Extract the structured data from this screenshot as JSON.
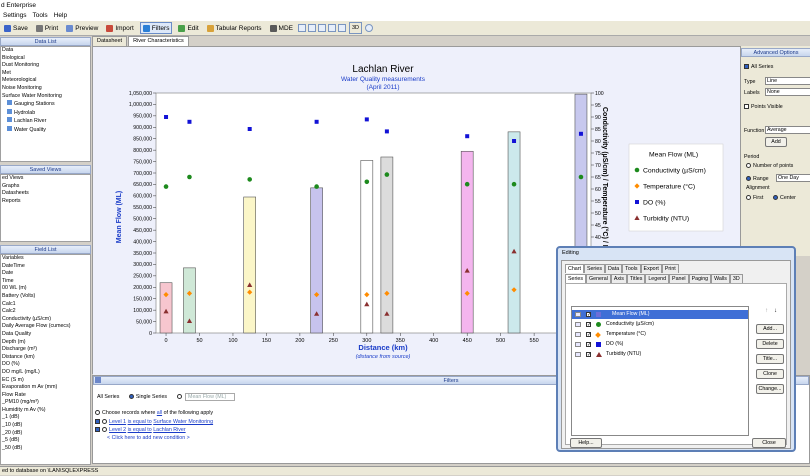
{
  "window": {
    "title": "d Enterprise"
  },
  "menu": [
    "Settings",
    "Tools",
    "Help"
  ],
  "toolbar": {
    "save": "Save",
    "print": "Print",
    "preview": "Preview",
    "import": "Import",
    "filters": "Filters",
    "edit": "Edit",
    "tabular": "Tabular Reports",
    "mde": "MDE",
    "threed": "3D"
  },
  "data_list": {
    "header": "Data List",
    "items": [
      "Data",
      "Biological",
      "Dust Monitoring",
      "Met",
      "Meteorological",
      "Noise Monitoring",
      "Surface Water Monitoring",
      "Gauging Stations",
      "Hydrolab",
      "Lachlan River",
      "Water Quality"
    ]
  },
  "saved_views": {
    "header": "Saved Views",
    "items": [
      "ed Views",
      "Graphs",
      "Datasheets",
      "Reports"
    ]
  },
  "field_list": {
    "header": "Field List",
    "items": [
      "Variables",
      "DateTime",
      "Date",
      "Time",
      "00 WL (m)",
      "Battery (Volts)",
      "Calc1",
      "Calc2",
      "Conductivity (µS/cm)",
      "Daily Average Flow (cumecs)",
      "Data Quality",
      "Depth (m)",
      "Discharge (m³)",
      "Distance (km)",
      "DO (%)",
      "DO mg/L (mg/L)",
      "EC (S m)",
      "Evaporation m Av (mm)",
      "Flow Rate",
      "_PM10 (mg/m³)",
      "Humidity m Av (%)",
      "_1 (dB)",
      "_10 (dB)",
      "_20 (dB)",
      "_5 (dB)",
      "_50 (dB)"
    ]
  },
  "tabs": [
    "Datasheet",
    "River Characteristics"
  ],
  "chart_data": {
    "type": "bar",
    "title": "Lachlan River",
    "subtitle": "Water Quality measurements",
    "subtitle2": "(April 2011)",
    "xlabel": "Distance (km)",
    "xlabel2": "(distance from source)",
    "ylabel": "Mean Flow (ML)",
    "y2label": "Conductivity (µS/cm) / Temperature (°C) / D",
    "xticks": [
      0,
      50,
      100,
      150,
      200,
      250,
      300,
      350,
      400,
      450,
      500,
      550
    ],
    "xlim": [
      -15,
      635
    ],
    "ylim": [
      0,
      1050000
    ],
    "yticks": [
      0,
      50000,
      100000,
      150000,
      200000,
      250000,
      300000,
      350000,
      400000,
      450000,
      500000,
      550000,
      600000,
      650000,
      700000,
      750000,
      800000,
      850000,
      900000,
      950000,
      1000000,
      1050000
    ],
    "ytick_labels": [
      "0",
      "50,000",
      "100,000",
      "150,000",
      "200,000",
      "250,000",
      "300,000",
      "350,000",
      "400,000",
      "450,000",
      "500,000",
      "550,000",
      "600,000",
      "650,000",
      "700,000",
      "750,000",
      "800,000",
      "850,000",
      "900,000",
      "950,000",
      "1,000,000",
      "1,050,000"
    ],
    "y2lim": [
      0,
      100
    ],
    "y2ticks": [
      0,
      5,
      10,
      15,
      20,
      25,
      30,
      35,
      40,
      45,
      50,
      55,
      60,
      65,
      70,
      75,
      80,
      85,
      90,
      95,
      100
    ],
    "sites": [
      {
        "x": 0,
        "flow": 220000,
        "color": "#f7c6cf",
        "cond": 61,
        "temp": 16,
        "do": 90,
        "turb": 9
      },
      {
        "x": 35,
        "flow": 285000,
        "color": "#cfe8d7",
        "cond": 65,
        "temp": 16.5,
        "do": 88,
        "turb": 5
      },
      {
        "x": 125,
        "flow": 595000,
        "color": "#fbf6c8",
        "cond": 64,
        "temp": 17,
        "do": 85,
        "turb": 20
      },
      {
        "x": 225,
        "flow": 635000,
        "color": "#c7c3ee",
        "cond": 61,
        "temp": 16,
        "do": 88,
        "turb": 8
      },
      {
        "x": 300,
        "flow": 755000,
        "color": "#ffffff",
        "cond": 63,
        "temp": 16,
        "do": 89,
        "turb": 12
      },
      {
        "x": 330,
        "flow": 770000,
        "color": "#dcdcdc",
        "cond": 66,
        "temp": 16.5,
        "do": 84,
        "turb": 8
      },
      {
        "x": 450,
        "flow": 795000,
        "color": "#f4b5ee",
        "cond": 62,
        "temp": 16.5,
        "do": 82,
        "turb": 26
      },
      {
        "x": 520,
        "flow": 880000,
        "color": "#cce9ec",
        "cond": 62,
        "temp": 18,
        "do": 80,
        "turb": 34
      },
      {
        "x": 620,
        "flow": 1045000,
        "color": "#c7c8ee",
        "cond": 65,
        "temp": null,
        "do": 83,
        "turb": null
      }
    ],
    "series": [
      {
        "name": "Mean Flow (ML)",
        "marker": "bar",
        "color": "#6e6ed8"
      },
      {
        "name": "Conductivity (µS/cm)",
        "marker": "circle",
        "color": "#1d8a1d"
      },
      {
        "name": "Temperature (°C)",
        "marker": "diamond",
        "color": "#ff8c00"
      },
      {
        "name": "DO (%)",
        "marker": "square",
        "color": "#1212d6"
      },
      {
        "name": "Turbidity (NTU)",
        "marker": "triangle",
        "color": "#8a3030"
      }
    ],
    "legend": "right"
  },
  "filters": {
    "header": "Filters",
    "all_series": "All Series",
    "single_series": "Single Series",
    "series_select": "Mean Flow (ML)",
    "choose_prefix": "Choose records where",
    "choose_all": "all",
    "choose_suffix": "of the following apply",
    "conditions": [
      {
        "level": "Level 1",
        "op": "is equal to",
        "value": "Surface Water Monitoring"
      },
      {
        "level": "Level 2",
        "op": "is equal to",
        "value": "Lachlan River"
      }
    ],
    "add_hint": "Click here to add new condition"
  },
  "advanced": {
    "header": "Advanced Options",
    "all_series": "All Series",
    "type_label": "Type",
    "type_value": "Line",
    "labels_label": "Labels",
    "labels_value": "None",
    "points_visible": "Points Visible",
    "function_label": "Function",
    "function_value": "Average",
    "add": "Add",
    "period_label": "Period",
    "number_of_points": "Number of points",
    "range_label": "Range",
    "range_value": "One Day",
    "alignment_label": "Alignment",
    "first": "First",
    "center": "Center"
  },
  "editing": {
    "title": "Editing",
    "tabs1": [
      "Chart",
      "Series",
      "Data",
      "Tools",
      "Export",
      "Print"
    ],
    "tabs2": [
      "Series",
      "General",
      "Axis",
      "Titles",
      "Legend",
      "Panel",
      "Paging",
      "Walls",
      "3D"
    ],
    "buttons": {
      "add": "Add...",
      "delete": "Delete",
      "title": "Title...",
      "clone": "Clone",
      "change": "Change...",
      "help": "Help...",
      "close": "Close"
    }
  },
  "status": "ed to database on \\LAN\\SQLEXPRESS"
}
